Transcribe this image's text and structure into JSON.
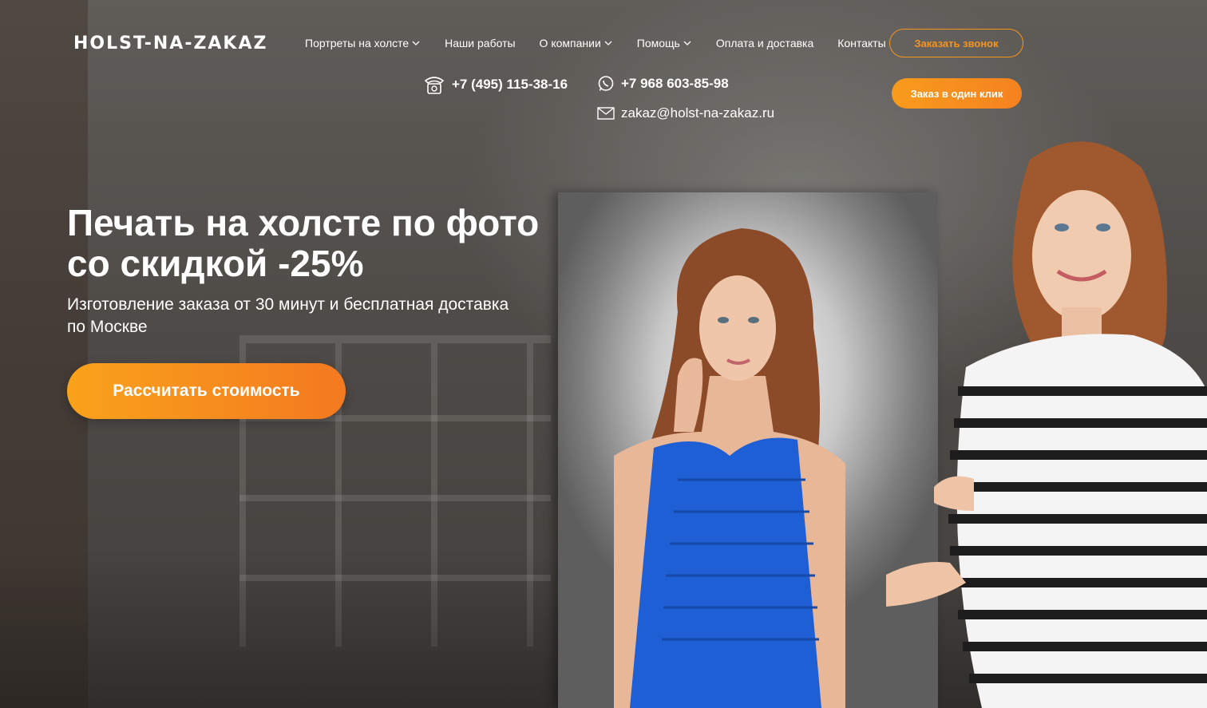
{
  "header": {
    "logo": "HOLST-NA-ZAKAZ",
    "nav": [
      {
        "label": "Портреты на холсте",
        "dropdown": true
      },
      {
        "label": "Наши работы",
        "dropdown": false
      },
      {
        "label": "О компании",
        "dropdown": true
      },
      {
        "label": "Помощь",
        "dropdown": true
      },
      {
        "label": "Оплата и доставка",
        "dropdown": false
      },
      {
        "label": "Контакты",
        "dropdown": false
      }
    ],
    "callback_button": "Заказать звонок",
    "one_click_button": "Заказ в один клик",
    "phone_main": "+7 (495) 115-38-16",
    "phone_whatsapp": "+7 968 603-85-98",
    "email": "zakaz@holst-na-zakaz.ru"
  },
  "hero": {
    "headline": "Печать на холсте по фото со скидкой -25%",
    "subtitle": "Изготовление заказа от 30 минут и бесплатная доставка по Москве",
    "cta_label": "Рассчитать стоимость"
  },
  "colors": {
    "accent": "#f7941d",
    "accent_dark": "#f47920",
    "text": "#ffffff"
  },
  "icons": [
    "telephone-icon",
    "whatsapp-icon",
    "envelope-icon",
    "chevron-down-icon"
  ]
}
